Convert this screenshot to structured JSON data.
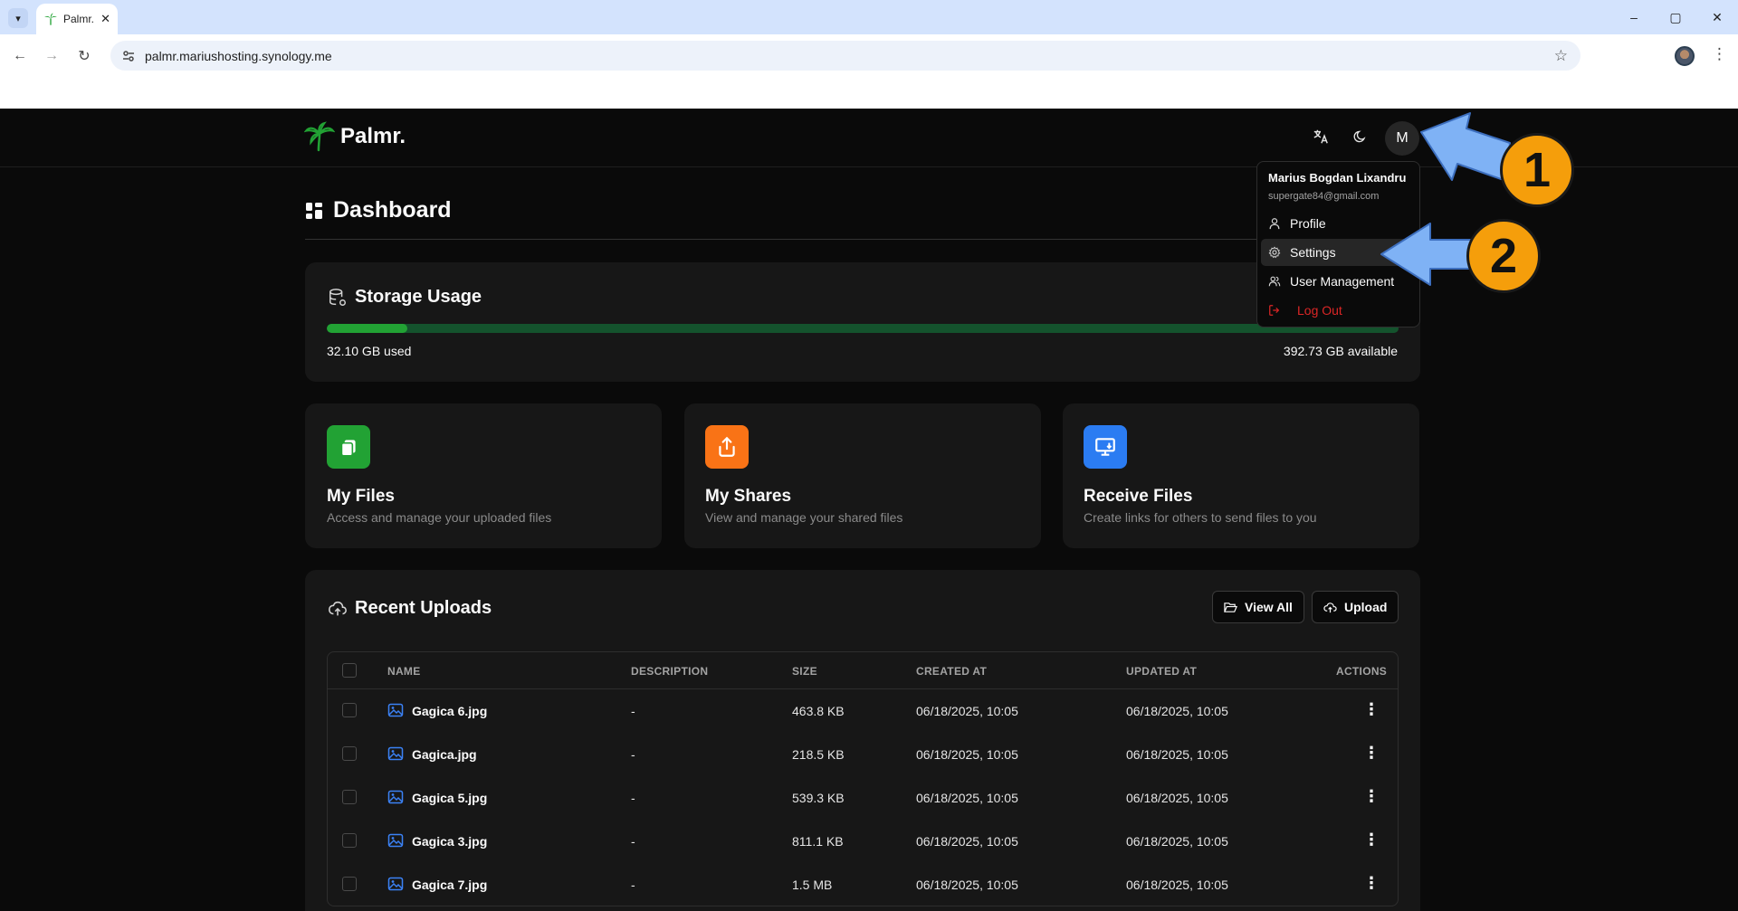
{
  "browser": {
    "tab_title": "Palmr.",
    "tab_close": "✕",
    "url": "palmr.mariushosting.synology.me",
    "window_controls": [
      "–",
      "▢",
      "✕"
    ],
    "nav": {
      "back": "←",
      "forward": "→",
      "reload": "↻"
    },
    "star": "☆",
    "menu": "⋮",
    "tab_menu": "▾"
  },
  "header": {
    "logo_text": "Palmr.",
    "avatar_initial": "M",
    "icons": [
      "translate-icon",
      "moon-icon"
    ]
  },
  "page": {
    "title": "Dashboard"
  },
  "storage": {
    "title": "Storage Usage",
    "used_label": "32.10 GB used",
    "available_label": "392.73 GB available",
    "used_fraction": 0.0755,
    "bar_color": "#22a234",
    "track_color": "#14532d"
  },
  "quick_cards": [
    {
      "title": "My Files",
      "description": "Access and manage your uploaded files",
      "color": "#22a234",
      "icon": "files-icon"
    },
    {
      "title": "My Shares",
      "description": "View and manage your shared files",
      "color": "#f97316",
      "icon": "share-icon"
    },
    {
      "title": "Receive Files",
      "description": "Create links for others to send files to you",
      "color": "#2b7cf2",
      "icon": "receive-icon"
    }
  ],
  "recent": {
    "title": "Recent Uploads",
    "view_all": "View All",
    "upload": "Upload",
    "columns": [
      "NAME",
      "DESCRIPTION",
      "SIZE",
      "CREATED AT",
      "UPDATED AT",
      "ACTIONS"
    ],
    "rows": [
      {
        "name": "Gagica 6.jpg",
        "description": "-",
        "size": "463.8 KB",
        "created": "06/18/2025, 10:05",
        "updated": "06/18/2025, 10:05"
      },
      {
        "name": "Gagica.jpg",
        "description": "-",
        "size": "218.5 KB",
        "created": "06/18/2025, 10:05",
        "updated": "06/18/2025, 10:05"
      },
      {
        "name": "Gagica 5.jpg",
        "description": "-",
        "size": "539.3 KB",
        "created": "06/18/2025, 10:05",
        "updated": "06/18/2025, 10:05"
      },
      {
        "name": "Gagica 3.jpg",
        "description": "-",
        "size": "811.1 KB",
        "created": "06/18/2025, 10:05",
        "updated": "06/18/2025, 10:05"
      },
      {
        "name": "Gagica 7.jpg",
        "description": "-",
        "size": "1.5 MB",
        "created": "06/18/2025, 10:05",
        "updated": "06/18/2025, 10:05"
      }
    ],
    "row_menu": "⋮"
  },
  "user_menu": {
    "name": "Marius Bogdan Lixandru",
    "email": "supergate84@gmail.com",
    "items": [
      {
        "label": "Profile",
        "icon": "user-icon"
      },
      {
        "label": "Settings",
        "icon": "gear-icon"
      },
      {
        "label": "User Management",
        "icon": "users-icon"
      },
      {
        "label": "Log Out",
        "icon": "logout-icon"
      }
    ]
  },
  "annotations": [
    "1",
    "2"
  ],
  "colors": {
    "accent_orange": "#f59e0b",
    "arrow_blue": "#7fb2f5",
    "danger": "#dc2626"
  }
}
